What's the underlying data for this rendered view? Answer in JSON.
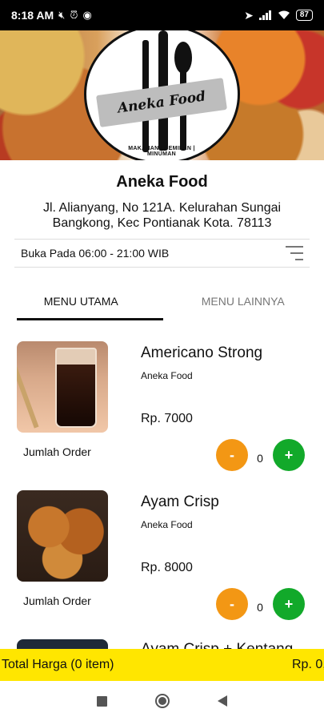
{
  "status_bar": {
    "time": "8:18 AM",
    "battery": "87",
    "icons_left": [
      "mute-icon",
      "alarm-icon",
      "discord-icon"
    ],
    "icons_right": [
      "location-icon",
      "signal-icon",
      "wifi-icon",
      "battery-icon"
    ]
  },
  "banner": {
    "logo_text": "Aneka Food",
    "logo_subtitle": "MAKANAN | CEMILAN | MINUMAN"
  },
  "store": {
    "name": "Aneka Food",
    "address": "Jl. Alianyang, No 121A. Kelurahan Sungai Bangkong, Kec Pontianak Kota. 78113",
    "hours": "Buka Pada 06:00 - 21:00 WIB"
  },
  "tabs": [
    {
      "label": "MENU UTAMA",
      "active": true
    },
    {
      "label": "MENU LAINNYA",
      "active": false
    }
  ],
  "menu_items": [
    {
      "name": "Americano Strong",
      "store": "Aneka Food",
      "price": "Rp. 7000",
      "order_label": "Jumlah Order",
      "qty": "0",
      "minus": "-",
      "plus": "+"
    },
    {
      "name": "Ayam Crisp",
      "store": "Aneka Food",
      "price": "Rp. 8000",
      "order_label": "Jumlah Order",
      "qty": "0",
      "minus": "-",
      "plus": "+"
    },
    {
      "name": "Ayam Crisp + Kentang"
    }
  ],
  "total": {
    "label": "Total Harga (0 item)",
    "price": "Rp. 0,-"
  },
  "colors": {
    "minus_button": "#f39714",
    "plus_button": "#12a92a",
    "total_bar": "#ffe600"
  }
}
